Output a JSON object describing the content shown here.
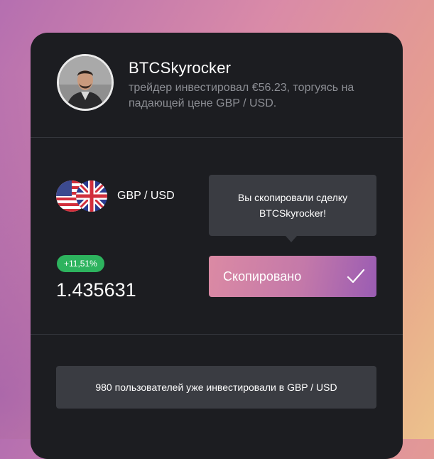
{
  "trader": {
    "name": "BTCSkyrocker",
    "description": "трейдер инвестировал €56.23, торгуясь на падающей цене GBP / USD."
  },
  "instrument": {
    "pair": "GBP / USD",
    "icons": [
      "us-flag-icon",
      "uk-flag-icon"
    ],
    "change_badge": "+11,51%",
    "price": "1.435631"
  },
  "tooltip": {
    "line1": "Вы скопировали сделку",
    "line2": "BTCSkyrocker!"
  },
  "copy_button": {
    "label": "Скопировано",
    "icon": "check-icon"
  },
  "users_info": "980 пользователей уже инвестировали в GBP / USD",
  "colors": {
    "card_bg": "#1c1d21",
    "badge_green": "#2db35e",
    "button_gradient_start": "#db8aa4",
    "button_gradient_end": "#9a5cb3",
    "tooltip_bg": "#3a3c42"
  }
}
